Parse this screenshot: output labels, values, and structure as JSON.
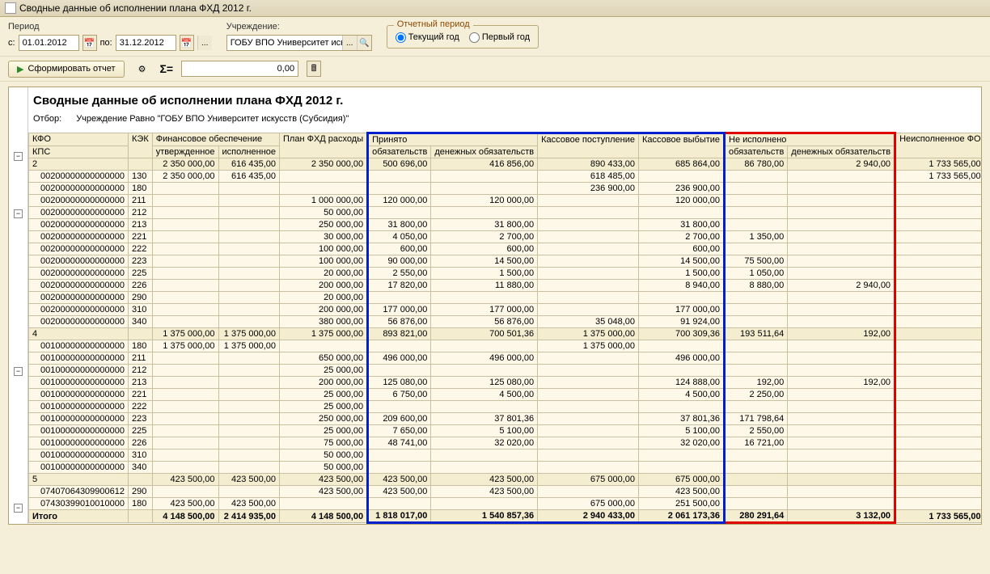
{
  "window": {
    "title": "Сводные данные об исполнении плана ФХД 2012 г."
  },
  "params": {
    "period_label": "Период",
    "from_label": "с:",
    "to_label": "по:",
    "from": "01.01.2012",
    "to": "31.12.2012",
    "org_label": "Учреждение:",
    "org_value": "ГОБУ ВПО Университет искусс...",
    "group_label": "Отчетный период",
    "radio_current": "Текущий год",
    "radio_first": "Первый год"
  },
  "actions": {
    "form_btn": "Сформировать отчет",
    "sigma": "Σ=",
    "sum_value": "0,00"
  },
  "report": {
    "title": "Сводные данные об исполнении плана ФХД 2012 г.",
    "filter_label": "Отбор:",
    "filter_text": "Учреждение Равно \"ГОБУ ВПО Университет искусств (Субсидия)\""
  },
  "headers": {
    "kfo": "КФО",
    "kps": "КПС",
    "kek": "КЭК",
    "fin": "Финансовое обеспечение",
    "approved": "утвержденное",
    "executed": "исполненное",
    "plan": "План ФХД расходы",
    "accepted": "Принято",
    "oblig": "обязательств",
    "money_oblig": "денежных обязательств",
    "cash_in": "Кассовое поступление",
    "cash_out": "Кассовое выбытие",
    "not_exec": "Не исполнено",
    "unexec_fo": "Неисполненное ФО"
  },
  "rows": [
    {
      "type": "sub",
      "kfo": "2",
      "approved": "2 350 000,00",
      "executed": "616 435,00",
      "plan": "2 350 000,00",
      "acc_ob": "500 696,00",
      "acc_mo": "416 856,00",
      "cin": "890 433,00",
      "cout": "685 864,00",
      "ne_ob": "86 780,00",
      "ne_mo": "2 940,00",
      "ufo": "1 733 565,00"
    },
    {
      "type": "d",
      "kfo": "00200000000000000",
      "kek": "130",
      "approved": "2 350 000,00",
      "executed": "616 435,00",
      "plan": "",
      "acc_ob": "",
      "acc_mo": "",
      "cin": "618 485,00",
      "cout": "",
      "ne_ob": "",
      "ne_mo": "",
      "ufo": "1 733 565,00"
    },
    {
      "type": "d",
      "kfo": "00200000000000000",
      "kek": "180",
      "approved": "",
      "executed": "",
      "plan": "",
      "acc_ob": "",
      "acc_mo": "",
      "cin": "236 900,00",
      "cout": "236 900,00",
      "ne_ob": "",
      "ne_mo": "",
      "ufo": ""
    },
    {
      "type": "d",
      "kfo": "00200000000000000",
      "kek": "211",
      "approved": "",
      "executed": "",
      "plan": "1 000 000,00",
      "acc_ob": "120 000,00",
      "acc_mo": "120 000,00",
      "cin": "",
      "cout": "120 000,00",
      "ne_ob": "",
      "ne_mo": "",
      "ufo": ""
    },
    {
      "type": "d",
      "kfo": "00200000000000000",
      "kek": "212",
      "approved": "",
      "executed": "",
      "plan": "50 000,00",
      "acc_ob": "",
      "acc_mo": "",
      "cin": "",
      "cout": "",
      "ne_ob": "",
      "ne_mo": "",
      "ufo": ""
    },
    {
      "type": "d",
      "kfo": "00200000000000000",
      "kek": "213",
      "approved": "",
      "executed": "",
      "plan": "250 000,00",
      "acc_ob": "31 800,00",
      "acc_mo": "31 800,00",
      "cin": "",
      "cout": "31 800,00",
      "ne_ob": "",
      "ne_mo": "",
      "ufo": ""
    },
    {
      "type": "d",
      "kfo": "00200000000000000",
      "kek": "221",
      "approved": "",
      "executed": "",
      "plan": "30 000,00",
      "acc_ob": "4 050,00",
      "acc_mo": "2 700,00",
      "cin": "",
      "cout": "2 700,00",
      "ne_ob": "1 350,00",
      "ne_mo": "",
      "ufo": ""
    },
    {
      "type": "d",
      "kfo": "00200000000000000",
      "kek": "222",
      "approved": "",
      "executed": "",
      "plan": "100 000,00",
      "acc_ob": "600,00",
      "acc_mo": "600,00",
      "cin": "",
      "cout": "600,00",
      "ne_ob": "",
      "ne_mo": "",
      "ufo": ""
    },
    {
      "type": "d",
      "kfo": "00200000000000000",
      "kek": "223",
      "approved": "",
      "executed": "",
      "plan": "100 000,00",
      "acc_ob": "90 000,00",
      "acc_mo": "14 500,00",
      "cin": "",
      "cout": "14 500,00",
      "ne_ob": "75 500,00",
      "ne_mo": "",
      "ufo": ""
    },
    {
      "type": "d",
      "kfo": "00200000000000000",
      "kek": "225",
      "approved": "",
      "executed": "",
      "plan": "20 000,00",
      "acc_ob": "2 550,00",
      "acc_mo": "1 500,00",
      "cin": "",
      "cout": "1 500,00",
      "ne_ob": "1 050,00",
      "ne_mo": "",
      "ufo": ""
    },
    {
      "type": "d",
      "kfo": "00200000000000000",
      "kek": "226",
      "approved": "",
      "executed": "",
      "plan": "200 000,00",
      "acc_ob": "17 820,00",
      "acc_mo": "11 880,00",
      "cin": "",
      "cout": "8 940,00",
      "ne_ob": "8 880,00",
      "ne_mo": "2 940,00",
      "ufo": ""
    },
    {
      "type": "d",
      "kfo": "00200000000000000",
      "kek": "290",
      "approved": "",
      "executed": "",
      "plan": "20 000,00",
      "acc_ob": "",
      "acc_mo": "",
      "cin": "",
      "cout": "",
      "ne_ob": "",
      "ne_mo": "",
      "ufo": ""
    },
    {
      "type": "d",
      "kfo": "00200000000000000",
      "kek": "310",
      "approved": "",
      "executed": "",
      "plan": "200 000,00",
      "acc_ob": "177 000,00",
      "acc_mo": "177 000,00",
      "cin": "",
      "cout": "177 000,00",
      "ne_ob": "",
      "ne_mo": "",
      "ufo": ""
    },
    {
      "type": "d",
      "kfo": "00200000000000000",
      "kek": "340",
      "approved": "",
      "executed": "",
      "plan": "380 000,00",
      "acc_ob": "56 876,00",
      "acc_mo": "56 876,00",
      "cin": "35 048,00",
      "cout": "91 924,00",
      "ne_ob": "",
      "ne_mo": "",
      "ufo": ""
    },
    {
      "type": "sub",
      "kfo": "4",
      "approved": "1 375 000,00",
      "executed": "1 375 000,00",
      "plan": "1 375 000,00",
      "acc_ob": "893 821,00",
      "acc_mo": "700 501,36",
      "cin": "1 375 000,00",
      "cout": "700 309,36",
      "ne_ob": "193 511,64",
      "ne_mo": "192,00",
      "ufo": ""
    },
    {
      "type": "d",
      "kfo": "00100000000000000",
      "kek": "180",
      "approved": "1 375 000,00",
      "executed": "1 375 000,00",
      "plan": "",
      "acc_ob": "",
      "acc_mo": "",
      "cin": "1 375 000,00",
      "cout": "",
      "ne_ob": "",
      "ne_mo": "",
      "ufo": ""
    },
    {
      "type": "d",
      "kfo": "00100000000000000",
      "kek": "211",
      "approved": "",
      "executed": "",
      "plan": "650 000,00",
      "acc_ob": "496 000,00",
      "acc_mo": "496 000,00",
      "cin": "",
      "cout": "496 000,00",
      "ne_ob": "",
      "ne_mo": "",
      "ufo": ""
    },
    {
      "type": "d",
      "kfo": "00100000000000000",
      "kek": "212",
      "approved": "",
      "executed": "",
      "plan": "25 000,00",
      "acc_ob": "",
      "acc_mo": "",
      "cin": "",
      "cout": "",
      "ne_ob": "",
      "ne_mo": "",
      "ufo": ""
    },
    {
      "type": "d",
      "kfo": "00100000000000000",
      "kek": "213",
      "approved": "",
      "executed": "",
      "plan": "200 000,00",
      "acc_ob": "125 080,00",
      "acc_mo": "125 080,00",
      "cin": "",
      "cout": "124 888,00",
      "ne_ob": "192,00",
      "ne_mo": "192,00",
      "ufo": ""
    },
    {
      "type": "d",
      "kfo": "00100000000000000",
      "kek": "221",
      "approved": "",
      "executed": "",
      "plan": "25 000,00",
      "acc_ob": "6 750,00",
      "acc_mo": "4 500,00",
      "cin": "",
      "cout": "4 500,00",
      "ne_ob": "2 250,00",
      "ne_mo": "",
      "ufo": ""
    },
    {
      "type": "d",
      "kfo": "00100000000000000",
      "kek": "222",
      "approved": "",
      "executed": "",
      "plan": "25 000,00",
      "acc_ob": "",
      "acc_mo": "",
      "cin": "",
      "cout": "",
      "ne_ob": "",
      "ne_mo": "",
      "ufo": ""
    },
    {
      "type": "d",
      "kfo": "00100000000000000",
      "kek": "223",
      "approved": "",
      "executed": "",
      "plan": "250 000,00",
      "acc_ob": "209 600,00",
      "acc_mo": "37 801,36",
      "cin": "",
      "cout": "37 801,36",
      "ne_ob": "171 798,64",
      "ne_mo": "",
      "ufo": ""
    },
    {
      "type": "d",
      "kfo": "00100000000000000",
      "kek": "225",
      "approved": "",
      "executed": "",
      "plan": "25 000,00",
      "acc_ob": "7 650,00",
      "acc_mo": "5 100,00",
      "cin": "",
      "cout": "5 100,00",
      "ne_ob": "2 550,00",
      "ne_mo": "",
      "ufo": ""
    },
    {
      "type": "d",
      "kfo": "00100000000000000",
      "kek": "226",
      "approved": "",
      "executed": "",
      "plan": "75 000,00",
      "acc_ob": "48 741,00",
      "acc_mo": "32 020,00",
      "cin": "",
      "cout": "32 020,00",
      "ne_ob": "16 721,00",
      "ne_mo": "",
      "ufo": ""
    },
    {
      "type": "d",
      "kfo": "00100000000000000",
      "kek": "310",
      "approved": "",
      "executed": "",
      "plan": "50 000,00",
      "acc_ob": "",
      "acc_mo": "",
      "cin": "",
      "cout": "",
      "ne_ob": "",
      "ne_mo": "",
      "ufo": ""
    },
    {
      "type": "d",
      "kfo": "00100000000000000",
      "kek": "340",
      "approved": "",
      "executed": "",
      "plan": "50 000,00",
      "acc_ob": "",
      "acc_mo": "",
      "cin": "",
      "cout": "",
      "ne_ob": "",
      "ne_mo": "",
      "ufo": ""
    },
    {
      "type": "sub",
      "kfo": "5",
      "approved": "423 500,00",
      "executed": "423 500,00",
      "plan": "423 500,00",
      "acc_ob": "423 500,00",
      "acc_mo": "423 500,00",
      "cin": "675 000,00",
      "cout": "675 000,00",
      "ne_ob": "",
      "ne_mo": "",
      "ufo": ""
    },
    {
      "type": "d",
      "kfo": "07407064309900612",
      "kek": "290",
      "approved": "",
      "executed": "",
      "plan": "423 500,00",
      "acc_ob": "423 500,00",
      "acc_mo": "423 500,00",
      "cin": "",
      "cout": "423 500,00",
      "ne_ob": "",
      "ne_mo": "",
      "ufo": ""
    },
    {
      "type": "d",
      "kfo": "07430399010010000",
      "kek": "180",
      "approved": "423 500,00",
      "executed": "423 500,00",
      "plan": "",
      "acc_ob": "",
      "acc_mo": "",
      "cin": "675 000,00",
      "cout": "251 500,00",
      "ne_ob": "",
      "ne_mo": "",
      "ufo": ""
    }
  ],
  "totals": {
    "label": "Итого",
    "approved": "4 148 500,00",
    "executed": "2 414 935,00",
    "plan": "4 148 500,00",
    "acc_ob": "1 818 017,00",
    "acc_mo": "1 540 857,36",
    "cin": "2 940 433,00",
    "cout": "2 061 173,36",
    "ne_ob": "280 291,64",
    "ne_mo": "3 132,00",
    "ufo": "1 733 565,00"
  }
}
